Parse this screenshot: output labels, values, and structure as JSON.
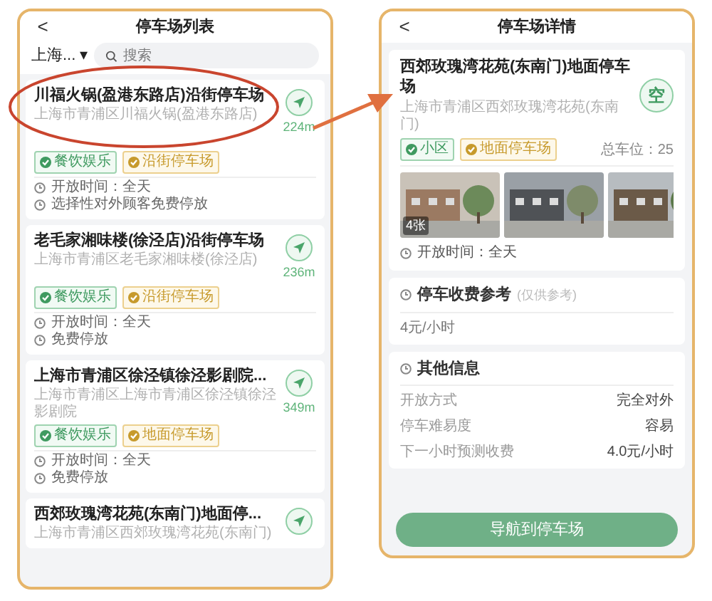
{
  "list_screen": {
    "title": "停车场列表",
    "back": "<",
    "city": "上海...",
    "city_caret": "▾",
    "search": {
      "placeholder": "搜索"
    },
    "lots": [
      {
        "name": "川福火锅(盈港东路店)沿街停车场",
        "address": "上海市青浦区川福火锅(盈港东路店)",
        "distance": "224m",
        "highlighted": true,
        "tags": [
          {
            "label": "餐饮娱乐",
            "kind": "category"
          },
          {
            "label": "沿街停车场",
            "kind": "parking"
          }
        ],
        "info": [
          "开放时间：全天",
          "选择性对外顾客免费停放"
        ]
      },
      {
        "name": "老毛家湘味楼(徐泾店)沿街停车场",
        "address": "上海市青浦区老毛家湘味楼(徐泾店)",
        "distance": "236m",
        "highlighted": false,
        "tags": [
          {
            "label": "餐饮娱乐",
            "kind": "category"
          },
          {
            "label": "沿街停车场",
            "kind": "parking"
          }
        ],
        "info": [
          "开放时间：全天",
          "免费停放"
        ]
      },
      {
        "name": "上海市青浦区徐泾镇徐泾影剧院...",
        "address": "上海市青浦区上海市青浦区徐泾镇徐泾影剧院",
        "distance": "349m",
        "highlighted": false,
        "tags": [
          {
            "label": "餐饮娱乐",
            "kind": "category"
          },
          {
            "label": "地面停车场",
            "kind": "parking"
          }
        ],
        "info": [
          "开放时间：全天",
          "免费停放"
        ]
      },
      {
        "name": "西郊玫瑰湾花苑(东南门)地面停...",
        "address": "上海市青浦区西郊玫瑰湾花苑(东南门)",
        "highlighted": false
      }
    ]
  },
  "detail_screen": {
    "title": "停车场详情",
    "back": "<",
    "name": "西郊玫瑰湾花苑(东南门)地面停车场",
    "status": "空",
    "address": "上海市青浦区西郊玫瑰湾花苑(东南门)",
    "tags": [
      {
        "label": "小区",
        "kind": "category"
      },
      {
        "label": "地面停车场",
        "kind": "parking"
      }
    ],
    "total_spaces": "总车位：25",
    "photos": [
      {
        "kind": "picture",
        "badge": "4张"
      },
      {
        "kind": "picture"
      },
      {
        "kind": "picture"
      }
    ],
    "open_hours": "开放时间：全天",
    "fee": {
      "title": "停车收费参考",
      "note": "(仅供参考)",
      "value": "4元/小时"
    },
    "other": {
      "title": "其他信息",
      "rows": [
        {
          "label": "开放方式",
          "value": "完全对外"
        },
        {
          "label": "停车难易度",
          "value": "容易"
        },
        {
          "label": "下一小时预测收费",
          "value": "4.0元/小时"
        }
      ]
    },
    "navigate_button": "导航到停车场"
  }
}
